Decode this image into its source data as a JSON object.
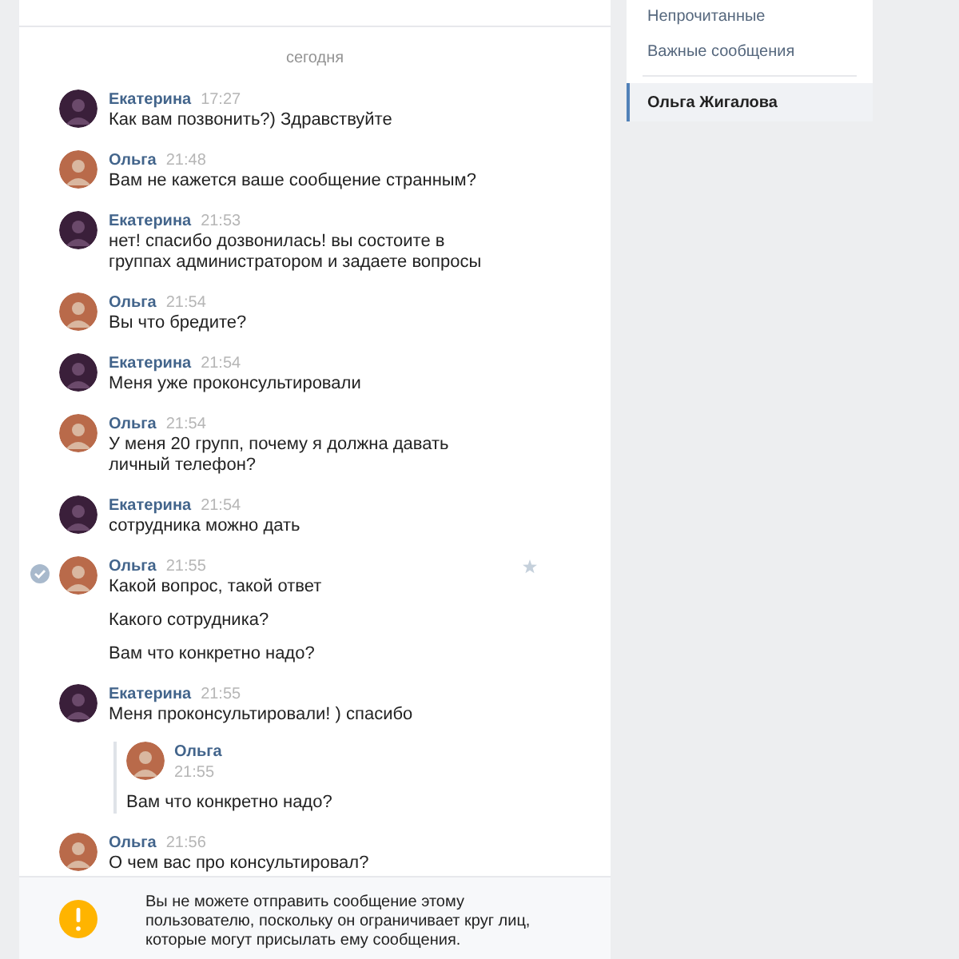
{
  "date_divider": "сегодня",
  "messages": [
    {
      "author": "Екатерина",
      "time": "17:27",
      "kind": "dark",
      "selected": false,
      "lines": [
        "Как вам позвонить?) Здравствуйте"
      ]
    },
    {
      "author": "Ольга",
      "time": "21:48",
      "kind": "light",
      "selected": false,
      "lines": [
        "Вам не кажется ваше сообщение странным?"
      ]
    },
    {
      "author": "Екатерина",
      "time": "21:53",
      "kind": "dark",
      "selected": false,
      "lines": [
        "нет! спасибо дозвонилась! вы состоите в группах администратором и задаете вопросы"
      ]
    },
    {
      "author": "Ольга",
      "time": "21:54",
      "kind": "light",
      "selected": false,
      "lines": [
        "Вы что бредите?"
      ]
    },
    {
      "author": "Екатерина",
      "time": "21:54",
      "kind": "dark",
      "selected": false,
      "lines": [
        "Меня уже проконсультировали"
      ]
    },
    {
      "author": "Ольга",
      "time": "21:54",
      "kind": "light",
      "selected": false,
      "lines": [
        "У меня 20 групп, почему я должна давать личный телефон?"
      ]
    },
    {
      "author": "Екатерина",
      "time": "21:54",
      "kind": "dark",
      "selected": false,
      "lines": [
        "сотрудника можно дать"
      ]
    },
    {
      "author": "Ольга",
      "time": "21:55",
      "kind": "light",
      "selected": true,
      "lines": [
        "Какой вопрос, такой ответ",
        "Какого сотрудника?",
        "Вам что конкретно надо?"
      ]
    },
    {
      "author": "Екатерина",
      "time": "21:55",
      "kind": "dark",
      "selected": false,
      "lines": [
        "Меня проконсультировали! ) спасибо"
      ],
      "forwarded": {
        "author": "Ольга",
        "time": "21:55",
        "kind": "light",
        "text": "Вам что конкретно надо?"
      }
    },
    {
      "author": "Ольга",
      "time": "21:56",
      "kind": "light",
      "selected": false,
      "lines": [
        "О чем вас про консультировал?"
      ]
    }
  ],
  "notice": "Вы не можете отправить сообщение этому пользователю, поскольку он ограничивает круг лиц, которые могут присылать ему сообщения.",
  "sidebar": {
    "items": [
      {
        "label": "Непрочитанные",
        "selected": false
      },
      {
        "label": "Важные сообщения",
        "selected": false
      }
    ],
    "dialogs": [
      {
        "label": "Ольга Жигалова",
        "selected": true
      }
    ]
  }
}
